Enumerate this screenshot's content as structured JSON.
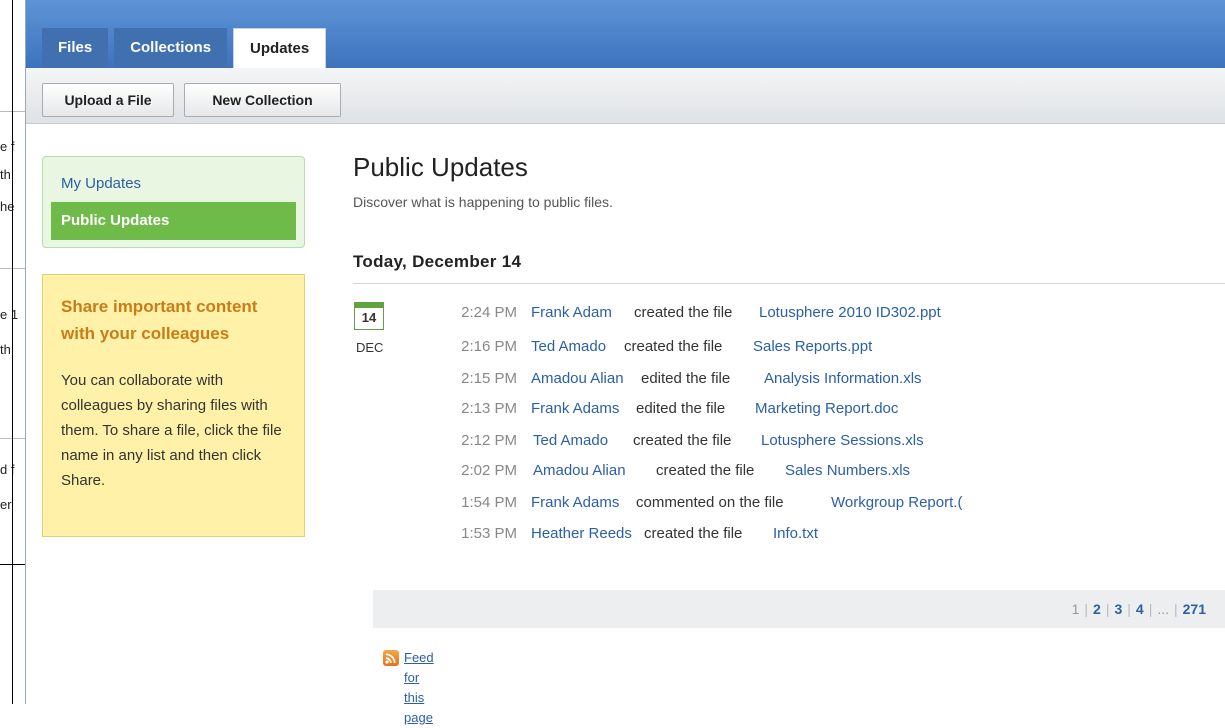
{
  "background_fragments": [
    "e f",
    "th",
    "he",
    "e 1",
    "th",
    "d f",
    "er"
  ],
  "tabs": [
    {
      "label": "Files",
      "active": false
    },
    {
      "label": "Collections",
      "active": false
    },
    {
      "label": "Updates",
      "active": true
    }
  ],
  "toolbar": {
    "upload_label": "Upload a File",
    "new_collection_label": "New Collection"
  },
  "nav": {
    "items": [
      {
        "label": "My Updates"
      },
      {
        "label": "Public Updates"
      }
    ]
  },
  "promo": {
    "title": "Share important content with your colleagues",
    "body": "You can collaborate with colleagues by sharing files with them. To share a file, click the file name in any list and then click Share."
  },
  "main": {
    "title": "Public Updates",
    "subtitle": "Discover what is happening to public files.",
    "day_heading": "Today, December 14",
    "calendar": {
      "day": "14",
      "month": "DEC"
    }
  },
  "updates": [
    {
      "time": "2:24 PM",
      "user": "Frank Adam",
      "action": "created the file",
      "file": "Lotusphere 2010 ID302.ppt"
    },
    {
      "time": "2:16 PM",
      "user": "Ted Amado",
      "action": "created the file",
      "file": "Sales Reports.ppt"
    },
    {
      "time": "2:15 PM",
      "user": "Amadou Alian",
      "action": "edited the file",
      "file": "Analysis Information.xls"
    },
    {
      "time": "2:13 PM",
      "user": "Frank Adams",
      "action": "edited the file",
      "file": "Marketing Report.doc"
    },
    {
      "time": "2:12 PM",
      "user": "Ted Amado",
      "action": "created the file",
      "file": "Lotusphere Sessions.xls"
    },
    {
      "time": "2:02 PM",
      "user": "Amadou Alian",
      "action": "created the file",
      "file": "Sales Numbers.xls"
    },
    {
      "time": "1:54 PM",
      "user": "Frank Adams",
      "action": "commented on the file",
      "file": "Workgroup Report.("
    },
    {
      "time": "1:53 PM",
      "user": "Heather Reeds",
      "action": "created the file",
      "file": "Info.txt"
    }
  ],
  "pager": {
    "current": "1",
    "pages": [
      "2",
      "3",
      "4"
    ],
    "ellipsis": "...",
    "last": "271"
  },
  "feed": {
    "label": "Feed for this page",
    "icon": "rss-feed-icon"
  }
}
